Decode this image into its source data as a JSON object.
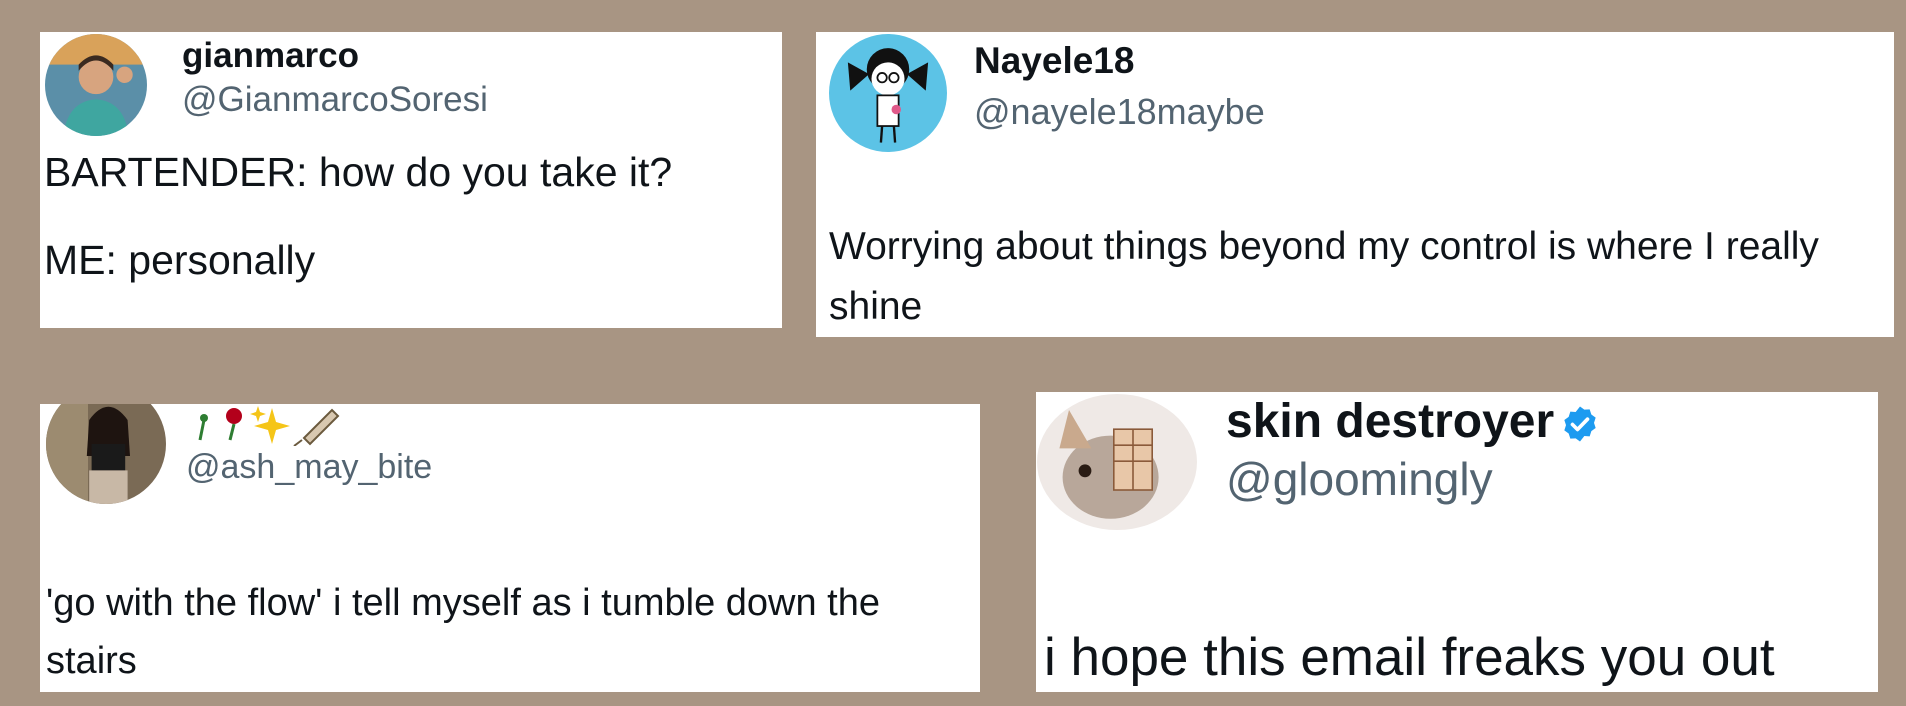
{
  "tweets": [
    {
      "name": "gianmarco",
      "handle": "@GianmarcoSoresi",
      "text": "BARTENDER: how do you take it?\n\nME: personally"
    },
    {
      "name": "Nayele18",
      "handle": "@nayele18maybe",
      "text": "Worrying about things beyond my control is where I really shine"
    },
    {
      "handle": "@ash_may_bite",
      "text": "'go with the flow' i tell myself as i tumble down the stairs"
    },
    {
      "name": "skin destroyer",
      "handle": "@gloomingly",
      "verified": true,
      "text": "i hope this email freaks you out"
    }
  ],
  "colors": {
    "background": "#a89583",
    "card": "#ffffff",
    "handle": "#536471",
    "verified": "#1d9bf0"
  }
}
